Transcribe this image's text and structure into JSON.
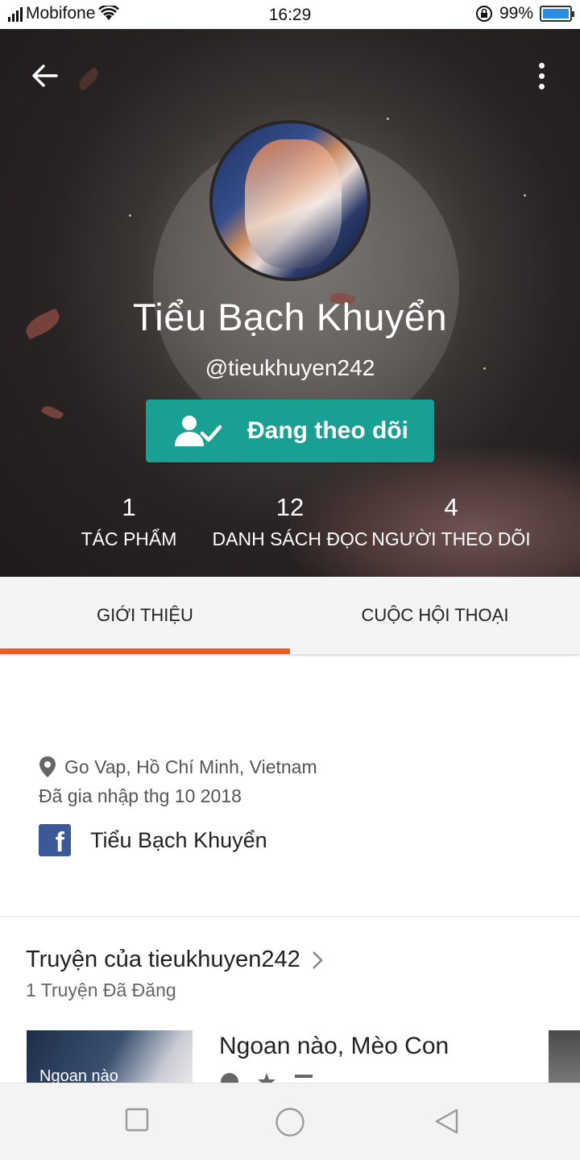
{
  "status_bar": {
    "carrier": "Mobifone",
    "time": "16:29",
    "battery": "99%",
    "battery_level": 0.99
  },
  "header": {
    "back_icon": "arrow-left-icon",
    "more_icon": "more-vertical-icon",
    "name": "Tiểu Bạch Khuyển",
    "handle": "@tieukhuyen242",
    "follow_button": "Đang theo dõi",
    "stats": [
      {
        "value": "1",
        "label": "TÁC PHẨM"
      },
      {
        "value": "12",
        "label": "DANH SÁCH ĐỌC"
      },
      {
        "value": "4",
        "label": "NGƯỜI THEO DÕI"
      }
    ]
  },
  "tabs": [
    {
      "label": "GIỚI THIỆU",
      "active": true
    },
    {
      "label": "CUỘC HỘI THOẠI",
      "active": false
    }
  ],
  "about": {
    "location": "Go Vap, Hồ Chí Minh, Vietnam",
    "joined": "Đã gia nhập thg 10 2018",
    "facebook_name": "Tiểu Bạch Khuyển"
  },
  "stories": {
    "title": "Truyện của tieukhuyen242",
    "subtitle": "1 Truyện Đã Đăng",
    "items": [
      {
        "title": "Ngoan nào, Mèo Con",
        "cover_text": "Ngoan nào"
      }
    ]
  },
  "colors": {
    "accent": "#f05a1a",
    "follow_button": "#1aa093",
    "facebook": "#3b5998"
  }
}
